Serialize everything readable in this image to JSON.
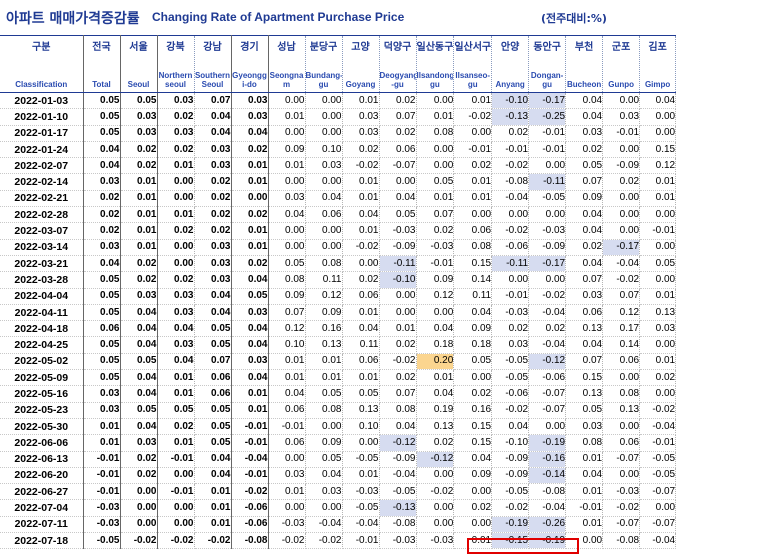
{
  "title": {
    "korean": "아파트 매매가격증감률",
    "english": "Changing Rate of Apartment Purchase Price",
    "unit": "(전주대비:%)"
  },
  "columns": [
    {
      "ko": "구분",
      "en": "Classification"
    },
    {
      "ko": "전국",
      "en": "Total"
    },
    {
      "ko": "서울",
      "en": "Seoul"
    },
    {
      "ko": "강북",
      "en": "Northern seoul"
    },
    {
      "ko": "강남",
      "en": "Southern Seoul"
    },
    {
      "ko": "경기",
      "en": "Gyeongg i-do"
    },
    {
      "ko": "성남",
      "en": "Seongna m"
    },
    {
      "ko": "분당구",
      "en": "Bundang-gu"
    },
    {
      "ko": "고양",
      "en": "Goyang"
    },
    {
      "ko": "덕양구",
      "en": "Deogyang -gu"
    },
    {
      "ko": "일산동구",
      "en": "Ilsandong-gu"
    },
    {
      "ko": "일산서구",
      "en": "Ilsanseo-gu"
    },
    {
      "ko": "안양",
      "en": "Anyang"
    },
    {
      "ko": "동안구",
      "en": "Dongan-gu"
    },
    {
      "ko": "부천",
      "en": "Bucheon"
    },
    {
      "ko": "군포",
      "en": "Gunpo"
    },
    {
      "ko": "김포",
      "en": "Gimpo"
    }
  ],
  "rows": [
    [
      "2022-01-03",
      "0.05",
      "0.05",
      "0.03",
      "0.07",
      "0.03",
      "0.00",
      "0.00",
      "0.01",
      "0.02",
      "0.00",
      "0.01",
      "-0.10",
      "-0.17",
      "0.04",
      "0.00",
      "0.04"
    ],
    [
      "2022-01-10",
      "0.05",
      "0.03",
      "0.02",
      "0.04",
      "0.03",
      "0.01",
      "0.00",
      "0.03",
      "0.07",
      "0.01",
      "-0.02",
      "-0.13",
      "-0.25",
      "0.04",
      "0.03",
      "0.00"
    ],
    [
      "2022-01-17",
      "0.05",
      "0.03",
      "0.03",
      "0.04",
      "0.04",
      "0.00",
      "0.00",
      "0.03",
      "0.02",
      "0.08",
      "0.00",
      "0.02",
      "-0.01",
      "0.03",
      "-0.01",
      "0.00"
    ],
    [
      "2022-01-24",
      "0.04",
      "0.02",
      "0.02",
      "0.03",
      "0.02",
      "0.09",
      "0.10",
      "0.02",
      "0.06",
      "0.00",
      "-0.01",
      "-0.01",
      "-0.01",
      "0.02",
      "0.00",
      "0.15"
    ],
    [
      "2022-02-07",
      "0.04",
      "0.02",
      "0.01",
      "0.03",
      "0.01",
      "0.01",
      "0.03",
      "-0.02",
      "-0.07",
      "0.00",
      "0.02",
      "-0.02",
      "0.00",
      "0.05",
      "-0.09",
      "0.12"
    ],
    [
      "2022-02-14",
      "0.03",
      "0.01",
      "0.00",
      "0.02",
      "0.01",
      "0.00",
      "0.00",
      "0.01",
      "0.00",
      "0.05",
      "0.01",
      "-0.08",
      "-0.11",
      "0.07",
      "0.02",
      "0.01"
    ],
    [
      "2022-02-21",
      "0.02",
      "0.01",
      "0.00",
      "0.02",
      "0.00",
      "0.03",
      "0.04",
      "0.01",
      "0.04",
      "0.01",
      "0.01",
      "-0.04",
      "-0.05",
      "0.09",
      "0.00",
      "0.01"
    ],
    [
      "2022-02-28",
      "0.02",
      "0.01",
      "0.01",
      "0.02",
      "0.02",
      "0.04",
      "0.06",
      "0.04",
      "0.05",
      "0.07",
      "0.00",
      "0.00",
      "0.00",
      "0.04",
      "0.00",
      "0.00"
    ],
    [
      "2022-03-07",
      "0.02",
      "0.01",
      "0.02",
      "0.02",
      "0.01",
      "0.00",
      "0.00",
      "0.01",
      "-0.03",
      "0.02",
      "0.06",
      "-0.02",
      "-0.03",
      "0.04",
      "0.00",
      "-0.01"
    ],
    [
      "2022-03-14",
      "0.03",
      "0.01",
      "0.00",
      "0.03",
      "0.01",
      "0.00",
      "0.00",
      "-0.02",
      "-0.09",
      "-0.03",
      "0.08",
      "-0.06",
      "-0.09",
      "0.02",
      "-0.17",
      "0.00"
    ],
    [
      "2022-03-21",
      "0.04",
      "0.02",
      "0.00",
      "0.03",
      "0.02",
      "0.05",
      "0.08",
      "0.00",
      "-0.11",
      "-0.01",
      "0.15",
      "-0.11",
      "-0.17",
      "0.04",
      "-0.04",
      "0.05"
    ],
    [
      "2022-03-28",
      "0.05",
      "0.02",
      "0.02",
      "0.03",
      "0.04",
      "0.08",
      "0.11",
      "0.02",
      "-0.10",
      "0.09",
      "0.14",
      "0.00",
      "0.00",
      "0.07",
      "-0.02",
      "0.00"
    ],
    [
      "2022-04-04",
      "0.05",
      "0.03",
      "0.03",
      "0.04",
      "0.05",
      "0.09",
      "0.12",
      "0.06",
      "0.00",
      "0.12",
      "0.11",
      "-0.01",
      "-0.02",
      "0.03",
      "0.07",
      "0.01"
    ],
    [
      "2022-04-11",
      "0.05",
      "0.04",
      "0.03",
      "0.04",
      "0.03",
      "0.07",
      "0.09",
      "0.01",
      "0.00",
      "0.00",
      "0.04",
      "-0.03",
      "-0.04",
      "0.06",
      "0.12",
      "0.13"
    ],
    [
      "2022-04-18",
      "0.06",
      "0.04",
      "0.04",
      "0.05",
      "0.04",
      "0.12",
      "0.16",
      "0.04",
      "0.01",
      "0.04",
      "0.09",
      "0.02",
      "0.02",
      "0.13",
      "0.17",
      "0.03"
    ],
    [
      "2022-04-25",
      "0.05",
      "0.04",
      "0.03",
      "0.05",
      "0.04",
      "0.10",
      "0.13",
      "0.11",
      "0.02",
      "0.18",
      "0.18",
      "0.03",
      "-0.04",
      "0.04",
      "0.14",
      "0.00"
    ],
    [
      "2022-05-02",
      "0.05",
      "0.05",
      "0.04",
      "0.07",
      "0.03",
      "0.01",
      "0.01",
      "0.06",
      "-0.02",
      "0.20",
      "0.05",
      "-0.05",
      "-0.12",
      "0.07",
      "0.06",
      "0.01"
    ],
    [
      "2022-05-09",
      "0.05",
      "0.04",
      "0.01",
      "0.06",
      "0.04",
      "0.01",
      "0.01",
      "0.01",
      "0.02",
      "0.01",
      "0.00",
      "-0.05",
      "-0.06",
      "0.15",
      "0.00",
      "0.02"
    ],
    [
      "2022-05-16",
      "0.03",
      "0.04",
      "0.01",
      "0.06",
      "0.01",
      "0.04",
      "0.05",
      "0.05",
      "0.07",
      "0.04",
      "0.02",
      "-0.06",
      "-0.07",
      "0.13",
      "0.08",
      "0.00"
    ],
    [
      "2022-05-23",
      "0.03",
      "0.05",
      "0.05",
      "0.05",
      "0.01",
      "0.06",
      "0.08",
      "0.13",
      "0.08",
      "0.19",
      "0.16",
      "-0.02",
      "-0.07",
      "0.05",
      "0.13",
      "-0.02"
    ],
    [
      "2022-05-30",
      "0.01",
      "0.04",
      "0.02",
      "0.05",
      "-0.01",
      "-0.01",
      "0.00",
      "0.10",
      "0.04",
      "0.13",
      "0.15",
      "0.04",
      "0.00",
      "0.03",
      "0.00",
      "-0.04"
    ],
    [
      "2022-06-06",
      "0.01",
      "0.03",
      "0.01",
      "0.05",
      "-0.01",
      "0.06",
      "0.09",
      "0.00",
      "-0.12",
      "0.02",
      "0.15",
      "-0.10",
      "-0.19",
      "0.08",
      "0.06",
      "-0.01"
    ],
    [
      "2022-06-13",
      "-0.01",
      "0.02",
      "-0.01",
      "0.04",
      "-0.04",
      "0.00",
      "0.05",
      "-0.05",
      "-0.09",
      "-0.12",
      "0.04",
      "-0.09",
      "-0.16",
      "0.01",
      "-0.07",
      "-0.05"
    ],
    [
      "2022-06-20",
      "-0.01",
      "0.02",
      "0.00",
      "0.04",
      "-0.01",
      "0.03",
      "0.04",
      "0.01",
      "-0.04",
      "0.00",
      "0.09",
      "-0.09",
      "-0.14",
      "0.04",
      "0.00",
      "-0.05"
    ],
    [
      "2022-06-27",
      "-0.01",
      "0.00",
      "-0.01",
      "0.01",
      "-0.02",
      "0.01",
      "0.03",
      "-0.03",
      "-0.05",
      "-0.02",
      "0.00",
      "-0.05",
      "-0.08",
      "0.01",
      "-0.03",
      "-0.07"
    ],
    [
      "2022-07-04",
      "-0.03",
      "0.00",
      "0.00",
      "0.01",
      "-0.06",
      "0.00",
      "0.00",
      "-0.05",
      "-0.13",
      "0.00",
      "0.02",
      "-0.02",
      "-0.04",
      "-0.01",
      "-0.02",
      "0.00"
    ],
    [
      "2022-07-11",
      "-0.03",
      "0.00",
      "0.00",
      "0.01",
      "-0.06",
      "-0.03",
      "-0.04",
      "-0.04",
      "-0.08",
      "0.00",
      "0.00",
      "-0.19",
      "-0.26",
      "0.01",
      "-0.07",
      "-0.07"
    ],
    [
      "2022-07-18",
      "-0.05",
      "-0.02",
      "-0.02",
      "-0.02",
      "-0.08",
      "-0.02",
      "-0.02",
      "-0.01",
      "-0.03",
      "-0.03",
      "0.01",
      "-0.15",
      "-0.19",
      "0.00",
      "-0.08",
      "-0.04"
    ]
  ],
  "highlights": {
    "blue": [
      [
        0,
        12
      ],
      [
        0,
        13
      ],
      [
        1,
        12
      ],
      [
        1,
        13
      ],
      [
        5,
        13
      ],
      [
        9,
        15
      ],
      [
        10,
        9
      ],
      [
        10,
        12
      ],
      [
        10,
        13
      ],
      [
        11,
        9
      ],
      [
        16,
        13
      ],
      [
        21,
        9
      ],
      [
        21,
        13
      ],
      [
        22,
        10
      ],
      [
        22,
        13
      ],
      [
        23,
        13
      ],
      [
        25,
        9
      ],
      [
        26,
        12
      ],
      [
        26,
        13
      ],
      [
        27,
        12
      ],
      [
        27,
        13
      ]
    ],
    "orange": [
      [
        16,
        10
      ]
    ]
  },
  "colors": {
    "title": "#1f3a93",
    "highlight_blue": "#d6dcf0",
    "highlight_orange": "#fbd58f",
    "red_box": "#e00000"
  }
}
